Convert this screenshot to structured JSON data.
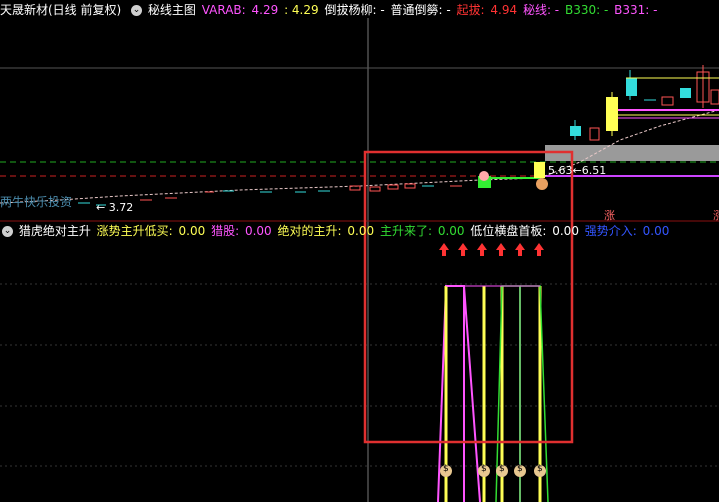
{
  "top": {
    "title": "天晟新材(日线 前复权)",
    "panel": "秘线主图",
    "varab_label": "VARAB:",
    "varab_v1": "4.29",
    "varab_v2": ": 4.29",
    "daoba": "倒拔杨柳: -",
    "putong": "普通倒簩: -",
    "qiba_label": "起拔:",
    "qiba_val": "4.94",
    "mixian": "秘线: -",
    "b330": "B330: -",
    "b331": "B331: -",
    "colors": {
      "yellow": "#ffff55",
      "magenta": "#ff55ff",
      "red": "#ff3333",
      "green": "#33dd33",
      "white": "#ffffff"
    }
  },
  "chart": {
    "watermark": "两牛快乐投资",
    "low_label": "← 3.72",
    "mid_label": "5.63←6.51",
    "zhang_label": "涨"
  },
  "indicator": {
    "title": "猎虎绝对主升",
    "items": [
      {
        "label": "涨势主升低买:",
        "value": "0.00",
        "color": "#ffff55"
      },
      {
        "label": "猎股:",
        "value": "0.00",
        "color": "#ff55ff"
      },
      {
        "label": "绝对的主升:",
        "value": "0.00",
        "color": "#ffff55"
      },
      {
        "label": "主升来了:",
        "value": "0.00",
        "color": "#33dd33"
      },
      {
        "label": "低位横盘首板:",
        "value": "0.00",
        "color": "#ffffff"
      },
      {
        "label": "强势介入:",
        "value": "0.00",
        "color": "#3355ff"
      }
    ],
    "money_icon": "$"
  }
}
